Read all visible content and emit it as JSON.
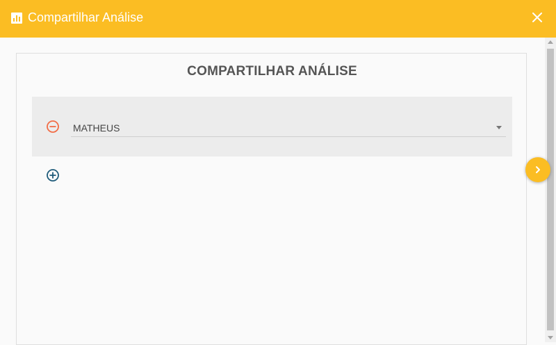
{
  "header": {
    "title": "Compartilhar Análise",
    "icon": "bar-chart-icon",
    "close_icon": "close-icon",
    "background_color": "#fbbd23"
  },
  "panel": {
    "title": "COMPARTILHAR ANÁLISE"
  },
  "share_rows": [
    {
      "user": "MATHEUS",
      "remove_icon": "minus-circle-icon",
      "remove_icon_color": "#f26c45"
    }
  ],
  "actions": {
    "add_icon": "plus-circle-icon",
    "add_icon_color": "#1e5b7a",
    "next_icon": "chevron-right-icon"
  }
}
